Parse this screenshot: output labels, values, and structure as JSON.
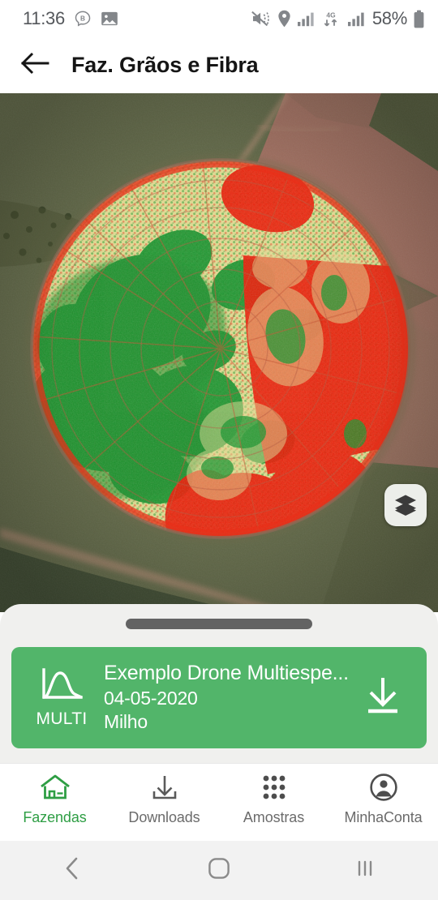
{
  "status_bar": {
    "time": "11:36",
    "battery_percent": "58%",
    "left_icons": [
      "chat-bubble-b-icon",
      "gallery-icon"
    ],
    "right_icons": [
      "mute-vibrate-icon",
      "location-pin-icon",
      "signal-bars-icon",
      "4g-data-icon",
      "signal-bars-2-icon",
      "battery-icon"
    ],
    "network_label": "4G",
    "text_color": "#55585c"
  },
  "app_bar": {
    "back_icon": "arrow-left-icon",
    "title": "Faz. Grãos e Fibra"
  },
  "map": {
    "type": "drone-ndvi-orthomosaic",
    "description": "Center-pivot circular field with NDVI red-yellow-green classification over aerial imagery",
    "layers_button_icon": "layers-icon",
    "colors": {
      "terrain_olive": "#5d6443",
      "terrain_dark_green": "#3c4430",
      "bare_soil_red": "#9e6a5c",
      "dirt_road": "#a8836f",
      "ndvi_green": "#179b2b",
      "ndvi_yellow": "#e3dc8a",
      "ndvi_red": "#f01b05"
    }
  },
  "bottom_sheet": {
    "drag_handle": "drag-handle",
    "handle_color": "#636363",
    "background": "#f0f0ee",
    "card": {
      "badge_icon": "spectral-curve-icon",
      "badge_label": "MULTI",
      "title": "Exemplo Drone Multiespe...",
      "date": "04-05-2020",
      "crop": "Milho",
      "download_icon": "download-icon",
      "color": "#52b56a"
    }
  },
  "tab_bar": {
    "accent_color": "#2e9e44",
    "inactive_color": "#6b6b6b",
    "items": [
      {
        "label": "Fazendas",
        "icon": "home-icon",
        "active": true
      },
      {
        "label": "Downloads",
        "icon": "download-icon",
        "active": false
      },
      {
        "label": "Amostras",
        "icon": "grid-dots-icon",
        "active": false
      },
      {
        "label": "MinhaConta",
        "icon": "account-circle-icon",
        "active": false
      }
    ]
  },
  "android_nav": {
    "back_icon": "nav-back-icon",
    "home_icon": "nav-home-icon",
    "recents_icon": "nav-recents-icon"
  }
}
